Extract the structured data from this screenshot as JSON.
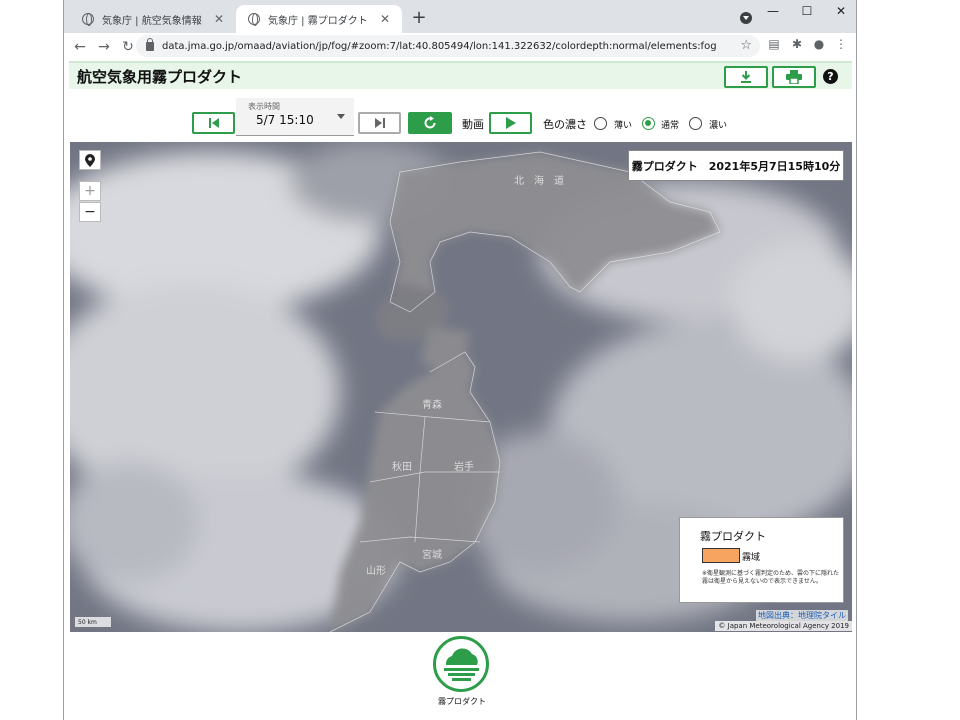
{
  "browser": {
    "tabs": [
      {
        "title": "気象庁 | 航空気象情報",
        "active": false
      },
      {
        "title": "気象庁 | 霧プロダクト",
        "active": true
      }
    ],
    "url": "data.jma.go.jp/omaad/aviation/jp/fog/#zoom:7/lat:40.805494/lon:141.322632/colordepth:normal/elements:fog"
  },
  "page": {
    "title": "航空気象用霧プロダクト",
    "download_icon": "download-icon",
    "print_icon": "print-icon",
    "help_label": "?"
  },
  "controls": {
    "time_label": "表示時間",
    "time_value": "5/7 15:10",
    "animation_label": "動画",
    "color_depth_label": "色の濃さ",
    "options": [
      {
        "label": "薄い",
        "selected": false
      },
      {
        "label": "通常",
        "selected": true
      },
      {
        "label": "濃い",
        "selected": false
      }
    ]
  },
  "map": {
    "info": "霧プロダクト　2021年5月7日15時10分",
    "zoom_in": "+",
    "zoom_out": "−",
    "legend": {
      "title": "霧プロダクト",
      "item_label": "霧域",
      "item_color": "#f6a460",
      "note": "※衛星観測に基づく霧判定のため、雲の下に隠れた霧は衛星から見えないので表示できません。"
    },
    "scale": "50 km",
    "attribution_link": "地図出典：地理院タイル",
    "copyright": "© Japan Meteorological Agency 2019",
    "place_labels": [
      {
        "name": "北　海　道"
      },
      {
        "name": "青森"
      },
      {
        "name": "秋田"
      },
      {
        "name": "岩手"
      },
      {
        "name": "宮城"
      },
      {
        "name": "山形"
      }
    ]
  },
  "product_button": {
    "label": "霧プロダクト",
    "accent": "#2e9d4a"
  }
}
